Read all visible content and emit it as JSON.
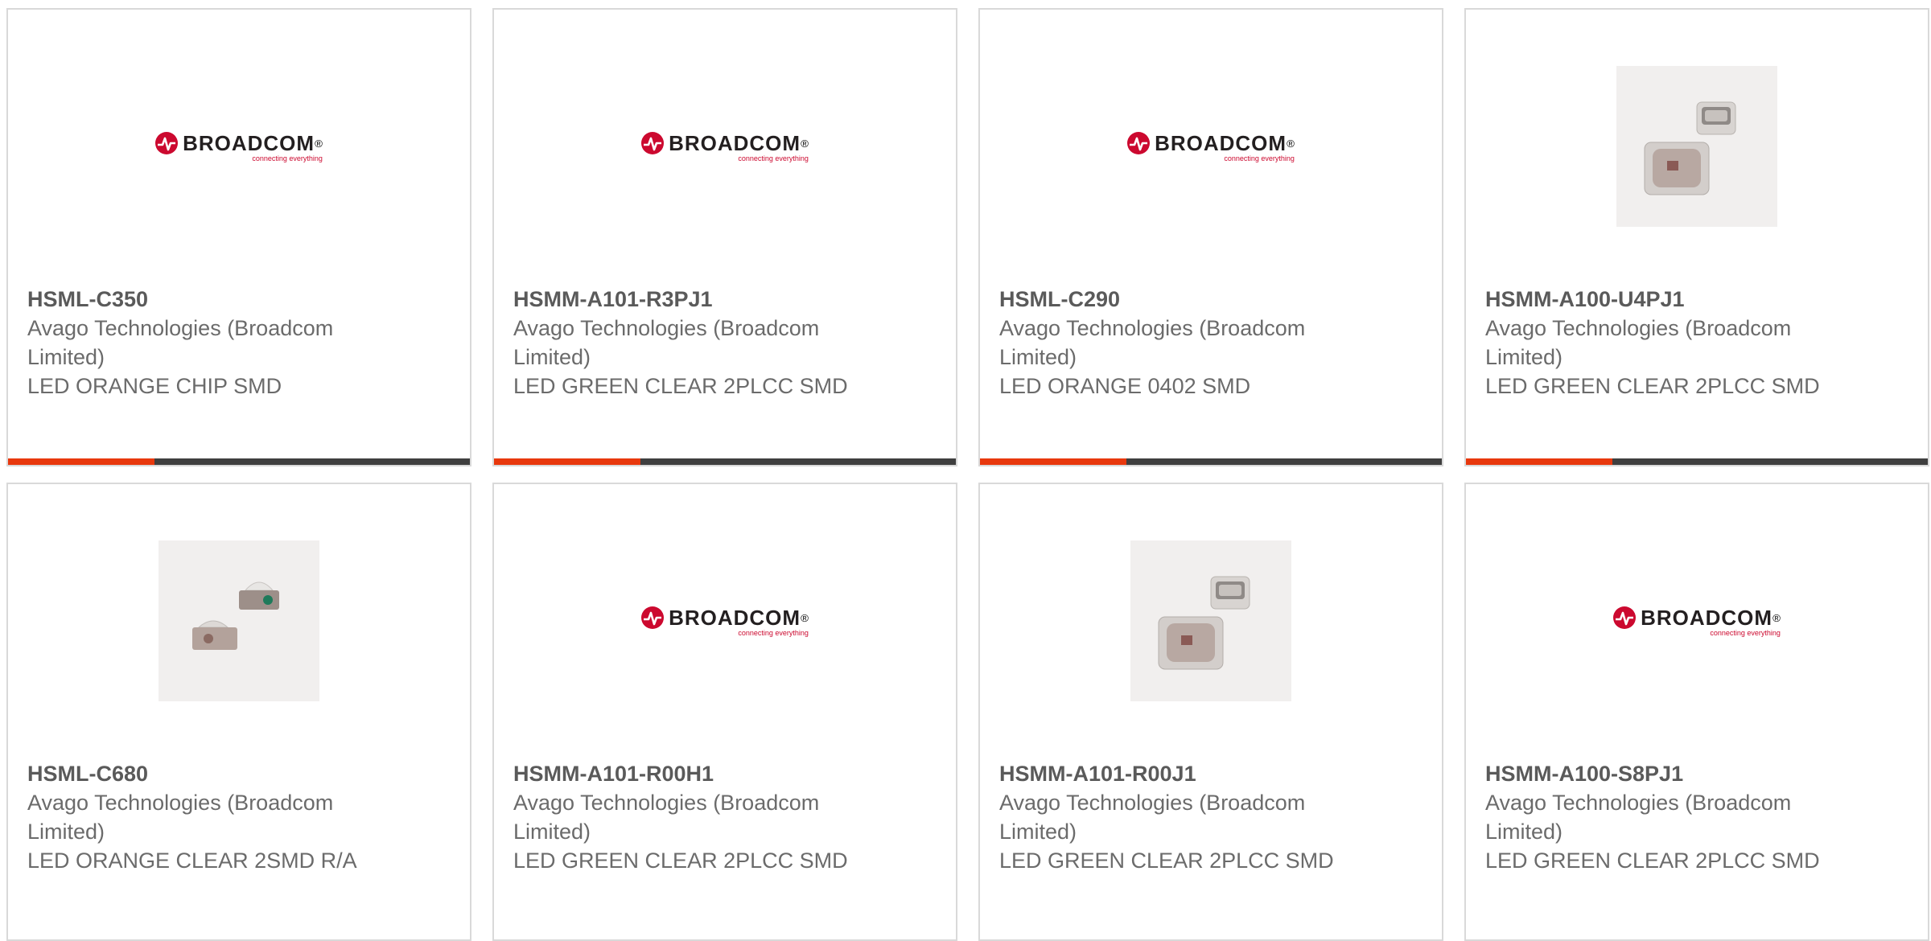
{
  "brand": {
    "logo_text": "BROADCOM",
    "logo_tagline": "connecting everything",
    "red": "#cc092f",
    "accent_bar": "#e8380d",
    "dark_bar": "#3f3f3f"
  },
  "products": [
    {
      "part_number": "HSML-C350",
      "manufacturer": "Avago Technologies (Broadcom Limited)",
      "description": "LED ORANGE CHIP SMD",
      "image": "broadcom-logo"
    },
    {
      "part_number": "HSMM-A101-R3PJ1",
      "manufacturer": "Avago Technologies (Broadcom Limited)",
      "description": "LED GREEN CLEAR 2PLCC SMD",
      "image": "broadcom-logo"
    },
    {
      "part_number": "HSML-C290",
      "manufacturer": "Avago Technologies (Broadcom Limited)",
      "description": "LED ORANGE 0402 SMD",
      "image": "broadcom-logo"
    },
    {
      "part_number": "HSMM-A100-U4PJ1",
      "manufacturer": "Avago Technologies (Broadcom Limited)",
      "description": "LED GREEN CLEAR 2PLCC SMD",
      "image": "plcc-led-photo"
    },
    {
      "part_number": "HSML-C680",
      "manufacturer": "Avago Technologies (Broadcom Limited)",
      "description": "LED ORANGE CLEAR 2SMD R/A",
      "image": "right-angle-led-photo"
    },
    {
      "part_number": "HSMM-A101-R00H1",
      "manufacturer": "Avago Technologies (Broadcom Limited)",
      "description": "LED GREEN CLEAR 2PLCC SMD",
      "image": "broadcom-logo"
    },
    {
      "part_number": "HSMM-A101-R00J1",
      "manufacturer": "Avago Technologies (Broadcom Limited)",
      "description": "LED GREEN CLEAR 2PLCC SMD",
      "image": "plcc-led-photo"
    },
    {
      "part_number": "HSMM-A100-S8PJ1",
      "manufacturer": "Avago Technologies (Broadcom Limited)",
      "description": "LED GREEN CLEAR 2PLCC SMD",
      "image": "broadcom-logo"
    }
  ]
}
